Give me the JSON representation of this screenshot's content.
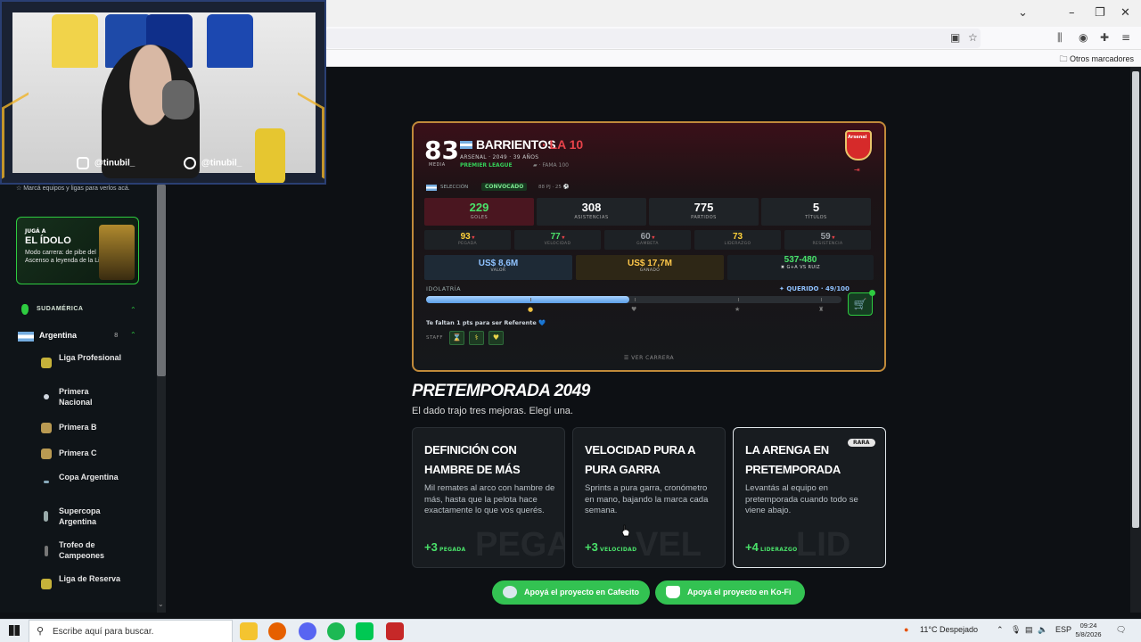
{
  "browser": {
    "bookmarks_label": "Otros marcadores"
  },
  "stream": {
    "instagram_handle": "@tinubil_",
    "tiktok_handle": "@tinubil_"
  },
  "sidebar": {
    "hint": "☆  Marcá equipos y ligas para verlos acá.",
    "promo": {
      "kicker": "JUGÁ A",
      "title": "EL ÍDOLO",
      "text": "Modo carrera: de pibe del Ascenso a leyenda de la Liga"
    },
    "region": "SUDAMÉRICA",
    "country": {
      "name": "Argentina",
      "count": "8"
    },
    "leagues": [
      "Liga Profesional",
      "Primera Nacional",
      "Primera B",
      "Primera C",
      "Copa Argentina",
      "Supercopa Argentina",
      "Trofeo de Campeones",
      "Liga de Reserva"
    ]
  },
  "player": {
    "rating": "83",
    "rating_label": "MEDIA",
    "name": "BARRIENTOS",
    "nickname": "· LA 10",
    "info": "ARSENAL · 2049 · 39 AÑOS",
    "league": "PREMIER LEAGUE",
    "fame": "FAMA 100",
    "club_crest_label": "Arsenal",
    "national": {
      "label": "SELECCIÓN",
      "status": "CONVOCADO",
      "stats": "88 PJ · 25 ⚽"
    },
    "big_stats": [
      {
        "value": "229",
        "label": "GOLES"
      },
      {
        "value": "308",
        "label": "ASISTENCIAS"
      },
      {
        "value": "775",
        "label": "PARTIDOS"
      },
      {
        "value": "5",
        "label": "TÍTULOS"
      }
    ],
    "attributes": [
      {
        "value": "93",
        "label": "PEGADA",
        "color": "#ffd23a"
      },
      {
        "value": "77",
        "label": "VELOCIDAD",
        "color": "#4ae26a"
      },
      {
        "value": "60",
        "label": "GAMBETA",
        "color": "#9aa0a6"
      },
      {
        "value": "73",
        "label": "LIDERAZGO",
        "color": "#ffd23a"
      },
      {
        "value": "59",
        "label": "RESISTENCIA",
        "color": "#9aa0a6"
      }
    ],
    "money": [
      {
        "value": "US$ 8,6M",
        "label": "VALOR"
      },
      {
        "value": "US$ 17,7M",
        "label": "GANADO"
      }
    ],
    "head_to_head": {
      "value": "537-480",
      "label": "G+A VS RUIZ"
    },
    "idolatry": {
      "label": "IDOLATRÍA",
      "status": "QUERIDO · 49/100",
      "value": 49,
      "max": 100
    },
    "referente_msg": "Te faltan 1 pts para ser Referente 💙",
    "staff_label": "STAFF",
    "career_link": "☰  VER CARRERA"
  },
  "preseason": {
    "title": "PRETEMPORADA 2049",
    "subtitle": "El dado trajo tres mejoras. Elegí una.",
    "options": [
      {
        "title": "DEFINICIÓN CON HAMBRE DE MÁS",
        "desc": "Mil remates al arco con hambre de más, hasta que la pelota hace exactamente lo que vos querés.",
        "bonus": "+3",
        "attr": "PEGADA",
        "watermark": "PEGADA",
        "rarity": ""
      },
      {
        "title": "VELOCIDAD PURA A PURA GARRA",
        "desc": "Sprints a pura garra, cronómetro en mano, bajando la marca cada semana.",
        "bonus": "+3",
        "attr": "VELOCIDAD",
        "watermark": "VEL",
        "rarity": ""
      },
      {
        "title": "LA ARENGA EN PRETEMPORADA",
        "desc": "Levantás al equipo en pretemporada cuando todo se viene abajo.",
        "bonus": "+4",
        "attr": "LIDERAZGO",
        "watermark": "LID",
        "rarity": "RARA"
      }
    ]
  },
  "support": {
    "cafecito": "Apoyá el proyecto en Cafecito",
    "kofi": "Apoyá el proyecto en Ko-Fi"
  },
  "taskbar": {
    "search_placeholder": "Escribe aquí para buscar.",
    "weather": "11°C  Despejado",
    "language": "ESP",
    "time": "09:24",
    "date": "5/8/2026"
  }
}
